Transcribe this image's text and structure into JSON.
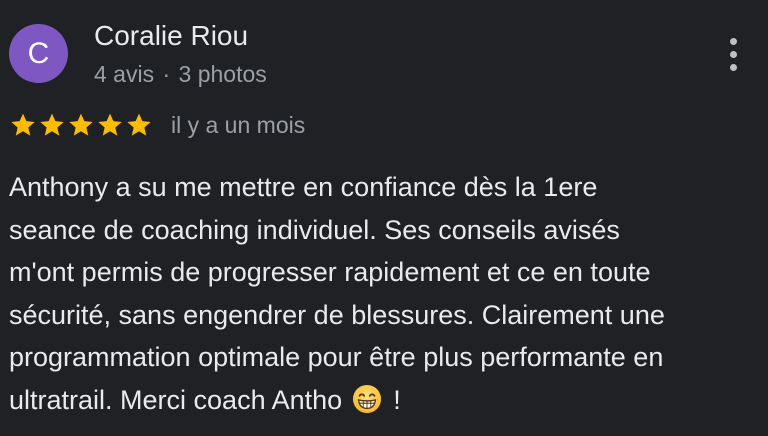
{
  "review": {
    "author": {
      "initial": "C",
      "name": "Coralie Riou",
      "review_count": "4 avis",
      "separator": "·",
      "photo_count": "3 photos",
      "avatar_color": "#7e57c2"
    },
    "menu_icon": "more-vert-icon",
    "rating": {
      "stars": 5,
      "max_stars": 5,
      "star_color": "#fbbc04"
    },
    "date": "il y a un mois",
    "text_lines": [
      "Anthony a su me mettre en confiance dès la 1ere",
      "seance de coaching individuel. Ses conseils avisés",
      "m'ont permis de progresser rapidement et ce en toute",
      "sécurité, sans engendrer de blessures. Clairement une",
      "programmation optimale pour être plus performante en"
    ],
    "last_line_text": "ultratrail. Merci coach Antho",
    "emoji": "grinning-face-with-smiling-eyes-emoji",
    "last_line_suffix": "!"
  }
}
